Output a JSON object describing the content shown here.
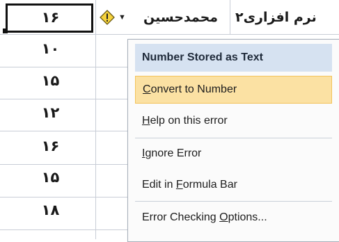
{
  "sheet": {
    "column_values": [
      "۱۶",
      "۱۰",
      "۱۵",
      "۱۲",
      "۱۶",
      "۱۵",
      "۱۸"
    ],
    "header_cells": [
      "محمدحسین",
      "نرم افزاری۲"
    ]
  },
  "error_button": {
    "icon": "warning-diamond-icon",
    "accent_color": "#f5d23c"
  },
  "menu": {
    "title": "Number Stored as Text",
    "items": [
      {
        "label": "Convert to Number",
        "access_key": "C"
      },
      {
        "label": "Help on this error",
        "access_key": "H"
      },
      {
        "label": "Ignore Error",
        "access_key": "I"
      },
      {
        "label": "Edit in Formula Bar",
        "access_key": "F"
      },
      {
        "label": "Error Checking Options...",
        "access_key": "O"
      }
    ],
    "colors": {
      "title_bg": "#d6e2f1",
      "hover_bg": "#fbe1a3"
    }
  }
}
